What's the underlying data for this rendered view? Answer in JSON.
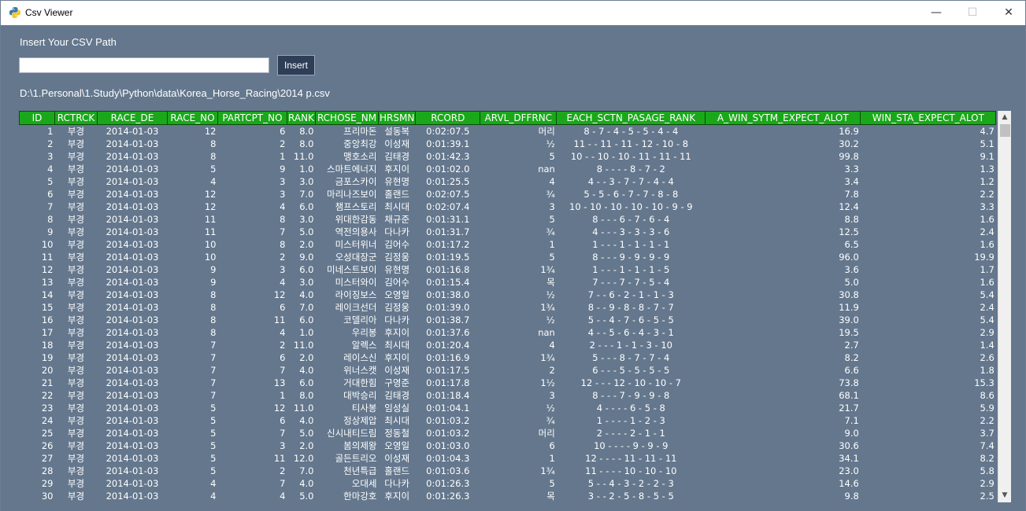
{
  "window": {
    "title": "Csv Viewer",
    "minimize_glyph": "—",
    "maximize_glyph": "☐",
    "close_glyph": "✕"
  },
  "form": {
    "path_label": "Insert Your CSV Path",
    "path_value": "",
    "insert_label": "Insert",
    "current_path": "D:\\1.Personal\\1.Study\\Python\\data\\Korea_Horse_Racing\\2014 p.csv"
  },
  "scrollbar": {
    "up_glyph": "▲",
    "down_glyph": "▼"
  },
  "table": {
    "columns": [
      "ID",
      "RCTRCK",
      "RACE_DE",
      "RACE_NO",
      "PARTCPT_NO",
      "RANK",
      "RCHOSE_NM",
      "HRSMN",
      "RCORD",
      "ARVL_DFFRNC",
      "EACH_SCTN_PASAGE_RANK",
      "A_WIN_SYTM_EXPECT_ALOT",
      "WIN_STA_EXPECT_ALOT"
    ],
    "rows": [
      [
        "1",
        "부경",
        "2014-01-03",
        "12",
        "6",
        "8.0",
        "프리마돈",
        "설동복",
        "0:02:07.5",
        "머리",
        "8 - 7 - 4 - 5 - 5 - 4 - 4",
        "16.9",
        "4.7"
      ],
      [
        "2",
        "부경",
        "2014-01-03",
        "8",
        "2",
        "8.0",
        "중앙최강",
        "이성재",
        "0:01:39.1",
        "½",
        "11 - - 11 - 11 - 12 - 10 - 8",
        "30.2",
        "5.1"
      ],
      [
        "3",
        "부경",
        "2014-01-03",
        "8",
        "1",
        "11.0",
        "맹호소리",
        "김태경",
        "0:01:42.3",
        "5",
        "10 - - 10 - 10 - 11 - 11 - 11",
        "99.8",
        "9.1"
      ],
      [
        "4",
        "부경",
        "2014-01-03",
        "5",
        "9",
        "1.0",
        "스마트에너지",
        "후지이",
        "0:01:02.0",
        "nan",
        "8 - - - - 8 - 7 - 2",
        "3.3",
        "1.3"
      ],
      [
        "5",
        "부경",
        "2014-01-03",
        "4",
        "3",
        "3.0",
        "금포스카이",
        "유현명",
        "0:01:25.5",
        "4",
        "4 - - 3 - 7 - 7 - 4 - 4",
        "3.4",
        "1.2"
      ],
      [
        "6",
        "부경",
        "2014-01-03",
        "12",
        "3",
        "7.0",
        "마리나즈보이",
        "홀랜드",
        "0:02:07.5",
        "¾",
        "5 - 5 - 6 - 7 - 7 - 8 - 8",
        "7.8",
        "2.2"
      ],
      [
        "7",
        "부경",
        "2014-01-03",
        "12",
        "4",
        "6.0",
        "챔프스토리",
        "최시대",
        "0:02:07.4",
        "3",
        "10 - 10 - 10 - 10 - 10 - 9 - 9",
        "12.4",
        "3.3"
      ],
      [
        "8",
        "부경",
        "2014-01-03",
        "11",
        "8",
        "3.0",
        "위대한감동",
        "채규준",
        "0:01:31.1",
        "5",
        "8 - - - 6 - 7 - 6 - 4",
        "8.8",
        "1.6"
      ],
      [
        "9",
        "부경",
        "2014-01-03",
        "11",
        "7",
        "5.0",
        "역전의용사",
        "다나카",
        "0:01:31.7",
        "¾",
        "4 - - - 3 - 3 - 3 - 6",
        "12.5",
        "2.4"
      ],
      [
        "10",
        "부경",
        "2014-01-03",
        "10",
        "8",
        "2.0",
        "미스터위너",
        "김어수",
        "0:01:17.2",
        "1",
        "1 - - - 1 - 1 - 1 - 1",
        "6.5",
        "1.6"
      ],
      [
        "11",
        "부경",
        "2014-01-03",
        "10",
        "2",
        "9.0",
        "오성대장군",
        "김정웅",
        "0:01:19.5",
        "5",
        "8 - - - 9 - 9 - 9 - 9",
        "96.0",
        "19.9"
      ],
      [
        "12",
        "부경",
        "2014-01-03",
        "9",
        "3",
        "6.0",
        "미네스트보이",
        "유현명",
        "0:01:16.8",
        "1¾",
        "1 - - - 1 - 1 - 1 - 5",
        "3.6",
        "1.7"
      ],
      [
        "13",
        "부경",
        "2014-01-03",
        "9",
        "4",
        "3.0",
        "미스터와이",
        "김어수",
        "0:01:15.4",
        "목",
        "7 - - - 7 - 7 - 5 - 4",
        "5.0",
        "1.6"
      ],
      [
        "14",
        "부경",
        "2014-01-03",
        "8",
        "12",
        "4.0",
        "라이징보스",
        "오영일",
        "0:01:38.0",
        "½",
        "7 - - 6 - 2 - 1 - 1 - 3",
        "30.8",
        "5.4"
      ],
      [
        "15",
        "부경",
        "2014-01-03",
        "8",
        "6",
        "7.0",
        "레이크선더",
        "김정웅",
        "0:01:39.0",
        "1¾",
        "8 - - 9 - 8 - 8 - 7 - 7",
        "11.9",
        "2.4"
      ],
      [
        "16",
        "부경",
        "2014-01-03",
        "8",
        "11",
        "6.0",
        "코델리아",
        "다나카",
        "0:01:38.7",
        "½",
        "5 - - 4 - 7 - 6 - 5 - 5",
        "39.0",
        "5.4"
      ],
      [
        "17",
        "부경",
        "2014-01-03",
        "8",
        "4",
        "1.0",
        "우리봉",
        "후지이",
        "0:01:37.6",
        "nan",
        "4 - - 5 - 6 - 4 - 3 - 1",
        "19.5",
        "2.9"
      ],
      [
        "18",
        "부경",
        "2014-01-03",
        "7",
        "2",
        "11.0",
        "알렉스",
        "최시대",
        "0:01:20.4",
        "4",
        "2 - - - 1 - 1 - 3 - 10",
        "2.7",
        "1.4"
      ],
      [
        "19",
        "부경",
        "2014-01-03",
        "7",
        "6",
        "2.0",
        "레이스신",
        "후지이",
        "0:01:16.9",
        "1¾",
        "5 - - - 8 - 7 - 7 - 4",
        "8.2",
        "2.6"
      ],
      [
        "20",
        "부경",
        "2014-01-03",
        "7",
        "7",
        "4.0",
        "위너스캣",
        "이성재",
        "0:01:17.5",
        "2",
        "6 - - - 5 - 5 - 5 - 5",
        "6.6",
        "1.8"
      ],
      [
        "21",
        "부경",
        "2014-01-03",
        "7",
        "13",
        "6.0",
        "거대한힘",
        "구영준",
        "0:01:17.8",
        "1½",
        "12 - - - 12 - 10 - 10 - 7",
        "73.8",
        "15.3"
      ],
      [
        "22",
        "부경",
        "2014-01-03",
        "7",
        "1",
        "8.0",
        "대박승리",
        "김태경",
        "0:01:18.4",
        "3",
        "8 - - - 7 - 9 - 9 - 8",
        "68.1",
        "8.6"
      ],
      [
        "23",
        "부경",
        "2014-01-03",
        "5",
        "12",
        "11.0",
        "티사봉",
        "임성실",
        "0:01:04.1",
        "½",
        "4 - - - - 6 - 5 - 8",
        "21.7",
        "5.9"
      ],
      [
        "24",
        "부경",
        "2014-01-03",
        "5",
        "6",
        "4.0",
        "정상제압",
        "최시대",
        "0:01:03.2",
        "¾",
        "1 - - - - 1 - 2 - 3",
        "7.1",
        "2.2"
      ],
      [
        "25",
        "부경",
        "2014-01-03",
        "5",
        "7",
        "5.0",
        "신시내티드림",
        "정동철",
        "0:01:03.2",
        "머리",
        "2 - - - - 2 - 1 - 1",
        "9.0",
        "3.7"
      ],
      [
        "26",
        "부경",
        "2014-01-03",
        "5",
        "3",
        "2.0",
        "봄의제왕",
        "오영일",
        "0:01:03.0",
        "6",
        "10 - - - - 9 - 9 - 9",
        "30.6",
        "7.4"
      ],
      [
        "27",
        "부경",
        "2014-01-03",
        "5",
        "11",
        "12.0",
        "골든트리오",
        "이성재",
        "0:01:04.3",
        "1",
        "12 - - - - 11 - 11 - 11",
        "34.1",
        "8.2"
      ],
      [
        "28",
        "부경",
        "2014-01-03",
        "5",
        "2",
        "7.0",
        "천년특급",
        "홀랜드",
        "0:01:03.6",
        "1¾",
        "11 - - - - 10 - 10 - 10",
        "23.0",
        "5.8"
      ],
      [
        "29",
        "부경",
        "2014-01-03",
        "4",
        "7",
        "4.0",
        "오대세",
        "다나카",
        "0:01:26.3",
        "5",
        "5 - - 4 - 3 - 2 - 2 - 3",
        "14.6",
        "2.9"
      ],
      [
        "30",
        "부경",
        "2014-01-03",
        "4",
        "4",
        "5.0",
        "한마강호",
        "후지이",
        "0:01:26.3",
        "목",
        "3 - - 2 - 5 - 8 - 5 - 5",
        "9.8",
        "2.5"
      ]
    ]
  },
  "colors": {
    "client_bg": "#64778d",
    "header_bg": "#1aa81a",
    "button_bg": "#2f3e57"
  }
}
